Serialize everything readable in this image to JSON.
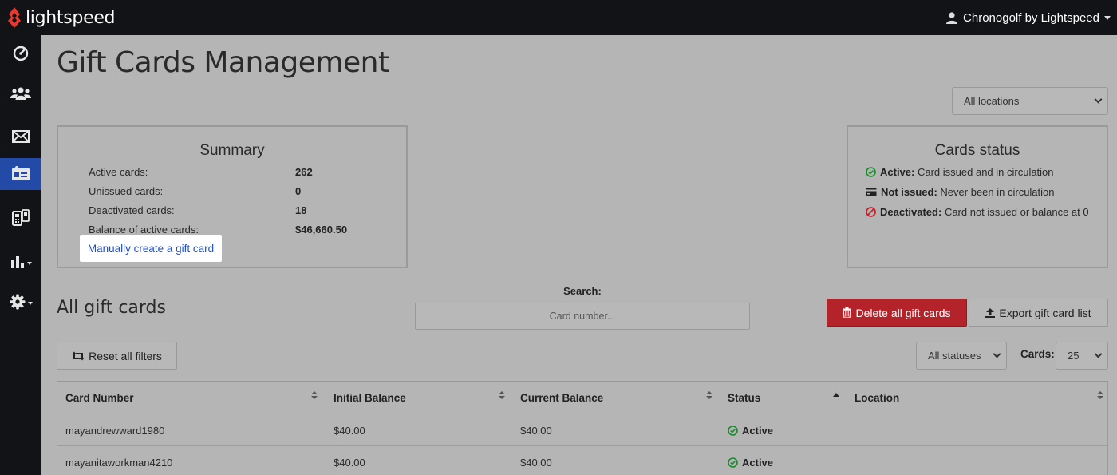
{
  "topbar": {
    "brand": "lightspeed",
    "user_name": "Chronogolf by Lightspeed"
  },
  "sidebar": {
    "items": [
      {
        "icon": "dashboard-icon"
      },
      {
        "icon": "users-icon"
      },
      {
        "icon": "envelope-icon"
      },
      {
        "icon": "gift-card-icon",
        "active": true
      },
      {
        "icon": "card-phone-icon"
      },
      {
        "icon": "bar-chart-icon"
      },
      {
        "icon": "gear-icon"
      }
    ]
  },
  "page": {
    "title": "Gift Cards Management",
    "location_select": "All locations"
  },
  "summary": {
    "title": "Summary",
    "rows": [
      {
        "label": "Active cards:",
        "value": "262"
      },
      {
        "label": "Unissued cards:",
        "value": "0"
      },
      {
        "label": "Deactivated cards:",
        "value": "18"
      },
      {
        "label": "Balance of active cards:",
        "value": "$46,660.50"
      }
    ],
    "manual_link": "Manually create a gift card"
  },
  "cards_status": {
    "title": "Cards status",
    "items": [
      {
        "term": "Active:",
        "desc": "Card issued and in circulation",
        "icon": "check-circle-icon"
      },
      {
        "term": "Not issued:",
        "desc": "Never been in circulation",
        "icon": "credit-card-icon"
      },
      {
        "term": "Deactivated:",
        "desc": "Card not issued or balance at 0",
        "icon": "ban-icon"
      }
    ]
  },
  "list": {
    "title": "All gift cards",
    "search_label": "Search:",
    "search_placeholder": "Card number...",
    "delete_all": "Delete all gift cards",
    "export": "Export gift card list",
    "reset_filters": "Reset all filters",
    "status_filter": "All statuses",
    "cards_label": "Cards:",
    "cards_per_page": "25"
  },
  "table": {
    "headers": [
      "Card Number",
      "Initial Balance",
      "Current Balance",
      "Status",
      "Location"
    ],
    "rows": [
      {
        "card": "mayandrewward1980",
        "initial": "$40.00",
        "current": "$40.00",
        "status": "Active",
        "location": ""
      },
      {
        "card": "mayanitaworkman4210",
        "initial": "$40.00",
        "current": "$40.00",
        "status": "Active",
        "location": ""
      }
    ]
  },
  "colors": {
    "topbar": "#121317",
    "active_nav": "#244aa8",
    "danger": "#b5232a",
    "link": "#1f4fd1",
    "success": "#1a8a2a",
    "deactivated": "#c0272d"
  }
}
